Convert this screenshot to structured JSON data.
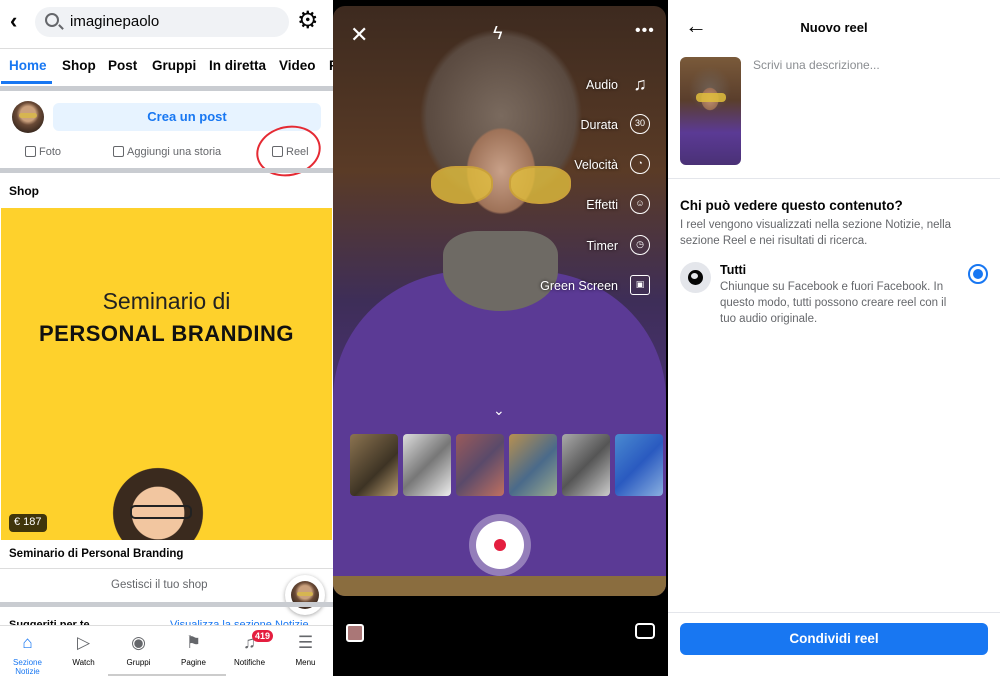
{
  "feed": {
    "search": {
      "value": "imaginepaolo"
    },
    "tabs": [
      "Home",
      "Shop",
      "Post",
      "Gruppi",
      "In diretta",
      "Video",
      "F"
    ],
    "create_post": "Crea un post",
    "actions": {
      "photo": "Foto",
      "story": "Aggiungi una storia",
      "reel": "Reel"
    },
    "shop_section": "Shop",
    "banner": {
      "line1": "Seminario di",
      "line2": "PERSONAL BRANDING",
      "price": "€ 187"
    },
    "product_name": "Seminario di Personal Branding",
    "manage_shop": "Gestisci il tuo shop",
    "suggested": "Suggeriti per te",
    "suggested_link": "Visualizza la sezione Notizie",
    "bottom_nav": [
      {
        "label": "Sezione Notizie",
        "icon": "home-icon"
      },
      {
        "label": "Watch",
        "icon": "watch-icon"
      },
      {
        "label": "Gruppi",
        "icon": "groups-icon"
      },
      {
        "label": "Pagine",
        "icon": "flag-icon"
      },
      {
        "label": "Notifiche",
        "icon": "bell-icon",
        "badge": "419"
      },
      {
        "label": "Menu",
        "icon": "menu-icon"
      }
    ],
    "accent": "#1877f2"
  },
  "camera": {
    "options": [
      "Audio",
      "Durata",
      "Velocità",
      "Effetti",
      "Timer",
      "Green Screen"
    ],
    "duration_value": "30"
  },
  "new_reel": {
    "title": "Nuovo reel",
    "description_placeholder": "Scrivi una descrizione...",
    "audience_title": "Chi può vedere questo contenuto?",
    "audience_info": "I reel vengono visualizzati nella sezione Notizie, nella sezione Reel e nei risultati di ricerca.",
    "option_title": "Tutti",
    "option_desc": "Chiunque su Facebook e fuori Facebook. In questo modo, tutti possono creare reel con il tuo audio originale.",
    "share_button": "Condividi reel"
  }
}
